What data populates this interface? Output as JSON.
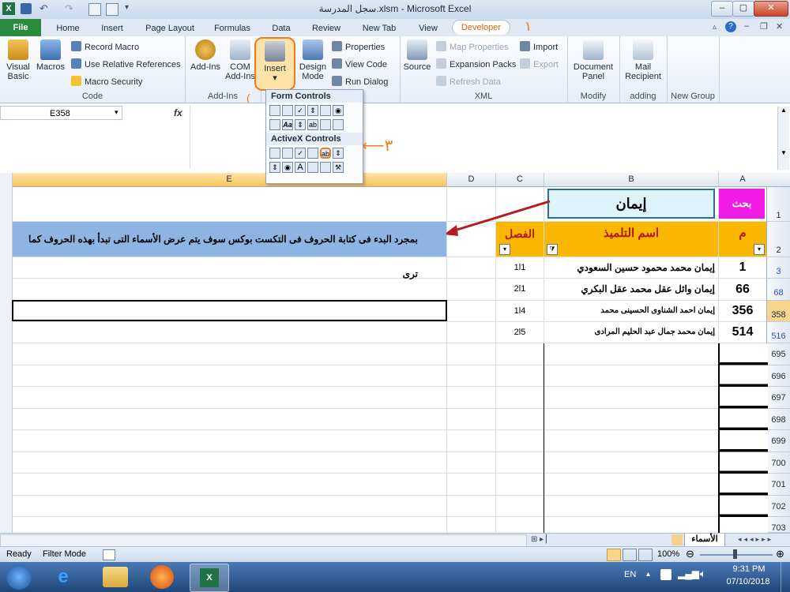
{
  "window": {
    "title": "سجل المدرسة.xlsm - Microsoft Excel",
    "min": "–",
    "max": "▢",
    "close": "✕"
  },
  "tabs": [
    "File",
    "Home",
    "Insert",
    "Page Layout",
    "Formulas",
    "Data",
    "Review",
    "New Tab",
    "View",
    "Developer"
  ],
  "ribbon": {
    "code": {
      "vb": "Visual Basic",
      "macros": "Macros",
      "record": "Record Macro",
      "relative": "Use Relative References",
      "security": "Macro Security",
      "label": "Code"
    },
    "addins": {
      "addins": "Add-Ins",
      "com": "COM Add-Ins",
      "label": "Add-Ins"
    },
    "controls": {
      "insert": "Insert",
      "design": "Design Mode",
      "properties": "Properties",
      "view_code": "View Code",
      "run_dialog": "Run Dialog"
    },
    "xml": {
      "source": "Source",
      "map_props": "Map Properties",
      "expansion": "Expansion Packs",
      "refresh": "Refresh Data",
      "import": "Import",
      "export": "Export",
      "label": "XML"
    },
    "modify": {
      "doc_panel": "Document Panel",
      "label": "Modify"
    },
    "adding": {
      "mail": "Mail Recipient",
      "label": "adding"
    },
    "new_group": "New Group"
  },
  "insert_menu": {
    "form": "Form Controls",
    "activex": "ActiveX Controls"
  },
  "annotations": {
    "one": "١",
    "three": "٣"
  },
  "namebox": "E358",
  "fx": "fx",
  "columns": [
    "E",
    "D",
    "C",
    "B",
    "A"
  ],
  "sheet": {
    "search_label": "بحث",
    "search_value": "إيمان",
    "header_m": "م",
    "header_name": "اسم التلميذ",
    "header_class": "الفصل",
    "note": "بمجرد البدء فى كتابة الحروف فى التكست بوكس سوف يتم عرض الأسماء التى تبدأ بهذه الحروف كما ترى",
    "rows": [
      {
        "rownum": "3",
        "m": "1",
        "name": "إيمان محمد محمود حسين السعودي",
        "cls": "1l1"
      },
      {
        "rownum": "68",
        "m": "66",
        "name": "إيمان وائل عقل محمد عقل البكري",
        "cls": "2l1"
      },
      {
        "rownum": "358",
        "m": "356",
        "name": "إيمان احمد الشناوى الحسينى محمد",
        "cls": "1l4"
      },
      {
        "rownum": "516",
        "m": "514",
        "name": "إيمان محمد جمال عبد الحليم المرادى",
        "cls": "2l5"
      }
    ],
    "empty_rows": [
      "695",
      "696",
      "697",
      "698",
      "699",
      "700",
      "701",
      "702",
      "703"
    ]
  },
  "sheet_tab": "الأسماء",
  "status": {
    "ready": "Ready",
    "mode": "Filter Mode",
    "zoom": "100%"
  },
  "taskbar": {
    "lang": "EN",
    "time": "9:31 PM",
    "date": "07/10/2018"
  },
  "colors": {
    "accent": "#f07a1c",
    "header_orange": "#f9b700",
    "search_pink": "#f21be5",
    "note_blue": "#8db4e3",
    "search_cyan": "#ddf4fb"
  }
}
